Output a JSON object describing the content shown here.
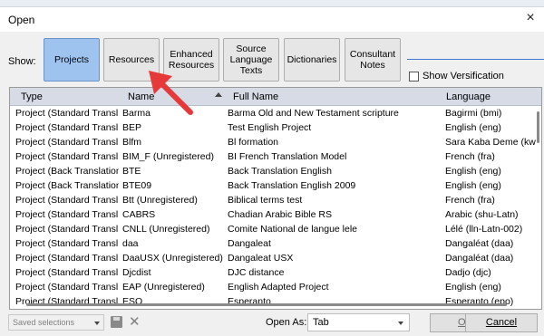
{
  "window": {
    "title": "Open",
    "close_glyph": "×"
  },
  "toolbar": {
    "show_label": "Show:",
    "buttons": [
      {
        "label": "Projects",
        "active": true
      },
      {
        "label": "Resources",
        "active": false
      },
      {
        "label": "Enhanced Resources",
        "active": false
      },
      {
        "label": "Source Language Texts",
        "active": false
      },
      {
        "label": "Dictionaries",
        "active": false
      },
      {
        "label": "Consultant Notes",
        "active": false
      }
    ],
    "show_versification_label": "Show Versification"
  },
  "table": {
    "headers": {
      "type": "Type",
      "name": "Name",
      "full_name": "Full Name",
      "language": "Language"
    },
    "rows": [
      {
        "type": "Project (Standard Transl...",
        "name": "Barma",
        "full_name": "Barma Old and New Testament scripture",
        "language": "Bagirmi (bmi)"
      },
      {
        "type": "Project (Standard Transl...",
        "name": "BEP",
        "full_name": "Test English Project",
        "language": "English (eng)"
      },
      {
        "type": "Project (Standard Transl...",
        "name": "Blfm",
        "full_name": "Bl formation",
        "language": "Sara Kaba Deme (kwg)"
      },
      {
        "type": "Project (Standard Transl...",
        "name": "BIM_F (Unregistered)",
        "full_name": "BI French Translation Model",
        "language": "French (fra)"
      },
      {
        "type": "Project (Back Translation)",
        "name": "BTE",
        "full_name": "Back Translation English",
        "language": "English (eng)"
      },
      {
        "type": "Project (Back Translation)",
        "name": "BTE09",
        "full_name": "Back Translation English 2009",
        "language": "English (eng)"
      },
      {
        "type": "Project (Standard Transl...",
        "name": "Btt (Unregistered)",
        "full_name": "Biblical terms test",
        "language": "French (fra)"
      },
      {
        "type": "Project (Standard Transl...",
        "name": "CABRS",
        "full_name": "Chadian Arabic Bible RS",
        "language": "Arabic (shu-Latn)"
      },
      {
        "type": "Project (Standard Transl...",
        "name": "CNLL (Unregistered)",
        "full_name": "Comite National de langue lele",
        "language": "Lélé (lln-Latn-002)"
      },
      {
        "type": "Project (Standard Transl...",
        "name": "daa",
        "full_name": "Dangaleat",
        "language": "Dangaléat (daa)"
      },
      {
        "type": "Project (Standard Transl...",
        "name": "DaaUSX (Unregistered)",
        "full_name": "Dangaleat USX",
        "language": "Dangaléat (daa)"
      },
      {
        "type": "Project (Standard Transl...",
        "name": "Djcdist",
        "full_name": "DJC distance",
        "language": "Dadjo (djc)"
      },
      {
        "type": "Project (Standard Transl...",
        "name": "EAP (Unregistered)",
        "full_name": "English Adapted Project",
        "language": "English (eng)"
      },
      {
        "type": "Project (Standard Transl...",
        "name": "ESO",
        "full_name": "Esperanto",
        "language": "Esperanto (epo)"
      }
    ]
  },
  "footer": {
    "saved_selections_placeholder": "Saved selections",
    "open_as_label": "Open As:",
    "open_as_value": "Tab",
    "ok_label": "OK",
    "cancel_label": "Cancel"
  },
  "icons": {
    "save": "save-icon",
    "delete": "delete-icon",
    "close": "close-icon",
    "pointer": "red-arrow-icon"
  },
  "colors": {
    "active_button": "#9fc3ef",
    "header_bg": "#d6dbe6",
    "annotation_arrow": "#e63a3a"
  }
}
